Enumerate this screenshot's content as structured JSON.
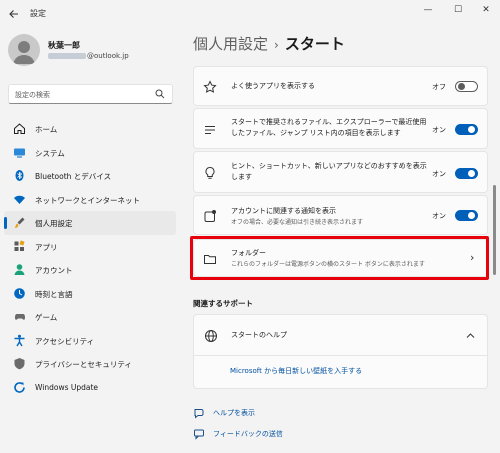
{
  "app": {
    "title": "設定",
    "back_icon": "back-arrow-icon",
    "window_controls": {
      "minimize": "—",
      "maximize": "☐",
      "close": "✕"
    }
  },
  "user": {
    "name": "秋葉一郎",
    "email_suffix": "@outlook.jp"
  },
  "search": {
    "placeholder": "設定の検索",
    "icon": "search-icon"
  },
  "sidebar": {
    "active_index": 4,
    "items": [
      {
        "label": "ホーム",
        "icon": "home-icon",
        "color": "#1f1f1f"
      },
      {
        "label": "システム",
        "icon": "system-icon",
        "color": "#0067c0"
      },
      {
        "label": "Bluetooth とデバイス",
        "icon": "bluetooth-icon",
        "color": "#0067c0"
      },
      {
        "label": "ネットワークとインターネット",
        "icon": "wifi-icon",
        "color": "#0067c0"
      },
      {
        "label": "個人用設定",
        "icon": "brush-icon",
        "color": "#5a5a5a"
      },
      {
        "label": "アプリ",
        "icon": "apps-icon",
        "color": "#5a5a5a"
      },
      {
        "label": "アカウント",
        "icon": "account-icon",
        "color": "#1aa37a"
      },
      {
        "label": "時刻と言語",
        "icon": "clock-globe-icon",
        "color": "#0067c0"
      },
      {
        "label": "ゲーム",
        "icon": "gamepad-icon",
        "color": "#6b6b6b"
      },
      {
        "label": "アクセシビリティ",
        "icon": "accessibility-icon",
        "color": "#0067c0"
      },
      {
        "label": "プライバシーとセキュリティ",
        "icon": "shield-icon",
        "color": "#5a5a5a"
      },
      {
        "label": "Windows Update",
        "icon": "update-icon",
        "color": "#0067c0"
      }
    ]
  },
  "breadcrumb": {
    "parent": "個人用設定",
    "separator": "›",
    "current": "スタート"
  },
  "settings": [
    {
      "id": "recent-apps",
      "label": "よく使うアプリを表示する",
      "state": "オフ",
      "on": false,
      "icon": "star-icon"
    },
    {
      "id": "recommended-files",
      "label": "スタートで推奨されるファイル、エクスプローラーで最近使用したファイル、ジャンプ リスト内の項目を表示します",
      "state": "オン",
      "on": true,
      "icon": "list-icon"
    },
    {
      "id": "tips",
      "label": "ヒント、ショートカット、新しいアプリなどのおすすめを表示します",
      "state": "オン",
      "on": true,
      "icon": "lightbulb-icon"
    },
    {
      "id": "account-notifications",
      "label": "アカウントに関連する通知を表示",
      "sublabel": "オフの場合、必要な通知は引き続き表示されます",
      "state": "オン",
      "on": true,
      "icon": "account-notification-icon"
    }
  ],
  "folders": {
    "label": "フォルダー",
    "description": "これらのフォルダーは電源ボタンの横のスタート ボタンに表示されます",
    "icon": "folder-icon",
    "chevron": "›"
  },
  "related": {
    "heading": "関連するサポート",
    "help_title": "スタートのヘルプ",
    "help_icon": "globe-icon",
    "chevron": "^",
    "link": "Microsoft から毎日新しい壁紙を入手する"
  },
  "footer": {
    "help_label": "ヘルプを表示",
    "feedback_label": "フィードバックの送信"
  },
  "colors": {
    "accent": "#005fb8",
    "highlight": "#e8000d",
    "link": "#0050a0"
  }
}
